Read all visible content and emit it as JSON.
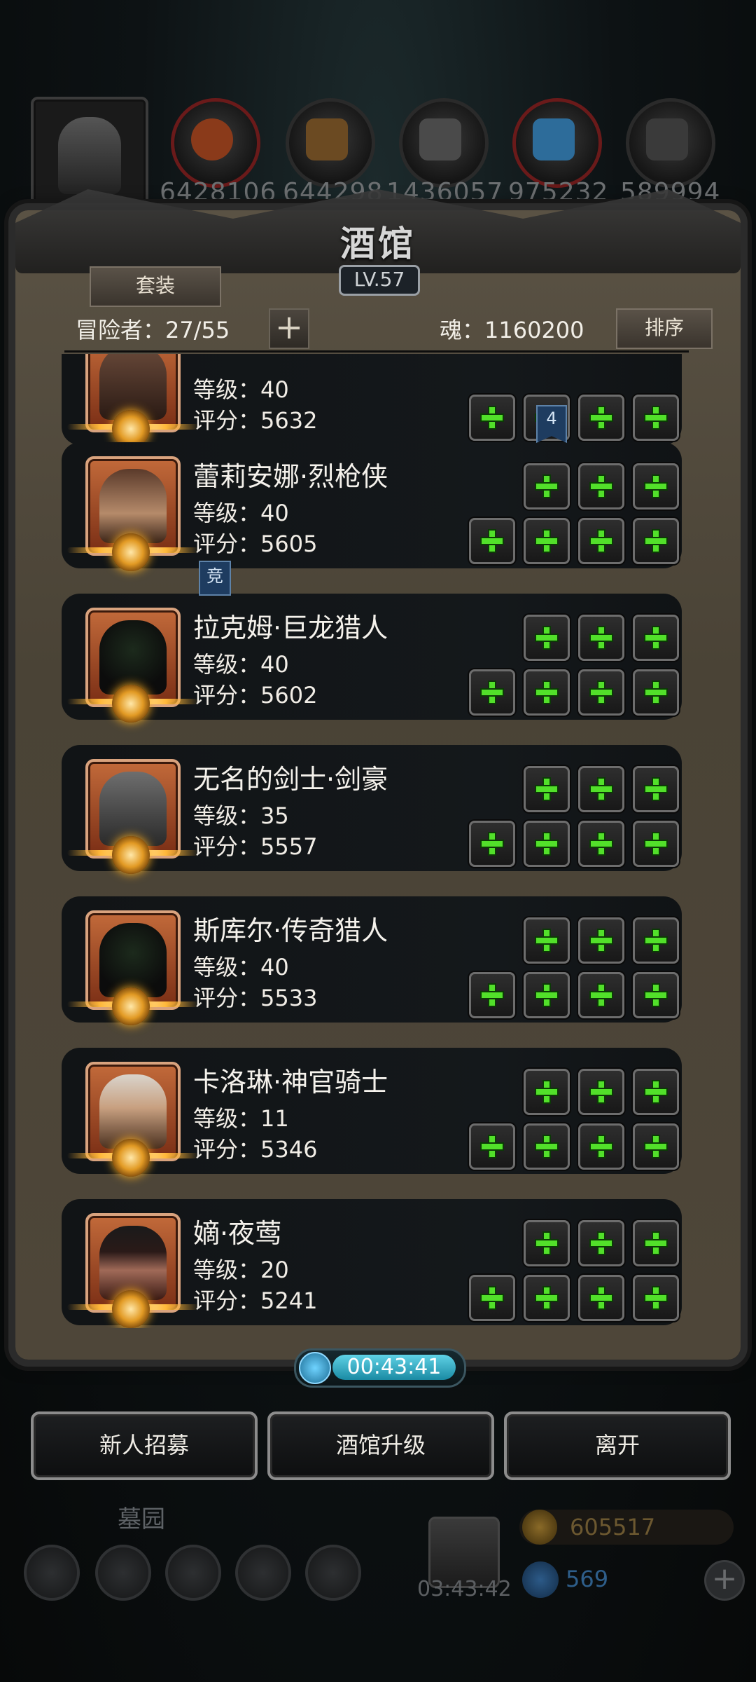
{
  "resources": {
    "values": [
      "6428106",
      "644298",
      "1436057",
      "975232",
      "589994"
    ]
  },
  "tavern": {
    "title": "酒馆",
    "level": "LV.57",
    "suit_button": "套装",
    "adventurer_count": "冒险者：27/55",
    "add_button": "+",
    "soul": "魂：1160200",
    "sort_button": "排序"
  },
  "heroes": [
    {
      "name": "",
      "level": "等级：40",
      "score": "评分：5632"
    },
    {
      "name": "蕾莉安娜·烈枪侠",
      "level": "等级：40",
      "score": "评分：5605"
    },
    {
      "name": "拉克姆·巨龙猎人",
      "level": "等级：40",
      "score": "评分：5602"
    },
    {
      "name": "无名的剑士·剑豪",
      "level": "等级：35",
      "score": "评分：5557"
    },
    {
      "name": "斯库尔·传奇猎人",
      "level": "等级：40",
      "score": "评分：5533"
    },
    {
      "name": "卡洛琳·神官骑士",
      "level": "等级：11",
      "score": "评分：5346"
    },
    {
      "name": "嫡·夜莺",
      "level": "等级：20",
      "score": "评分：5241"
    }
  ],
  "tags": {
    "rank_badge": "4",
    "competitive_badge": "竞"
  },
  "timer": "00:43:41",
  "actions": {
    "recruit": "新人招募",
    "upgrade": "酒馆升级",
    "leave": "离开"
  },
  "hud": {
    "graveyard_label": "墓园",
    "gift_timer": "03:43:42",
    "gold": "605517",
    "gems": "569"
  },
  "colors": {
    "equip_plus": "#52e02a",
    "timer_bar": "#5fd2e6",
    "portrait_frame": "#c26a3a"
  }
}
